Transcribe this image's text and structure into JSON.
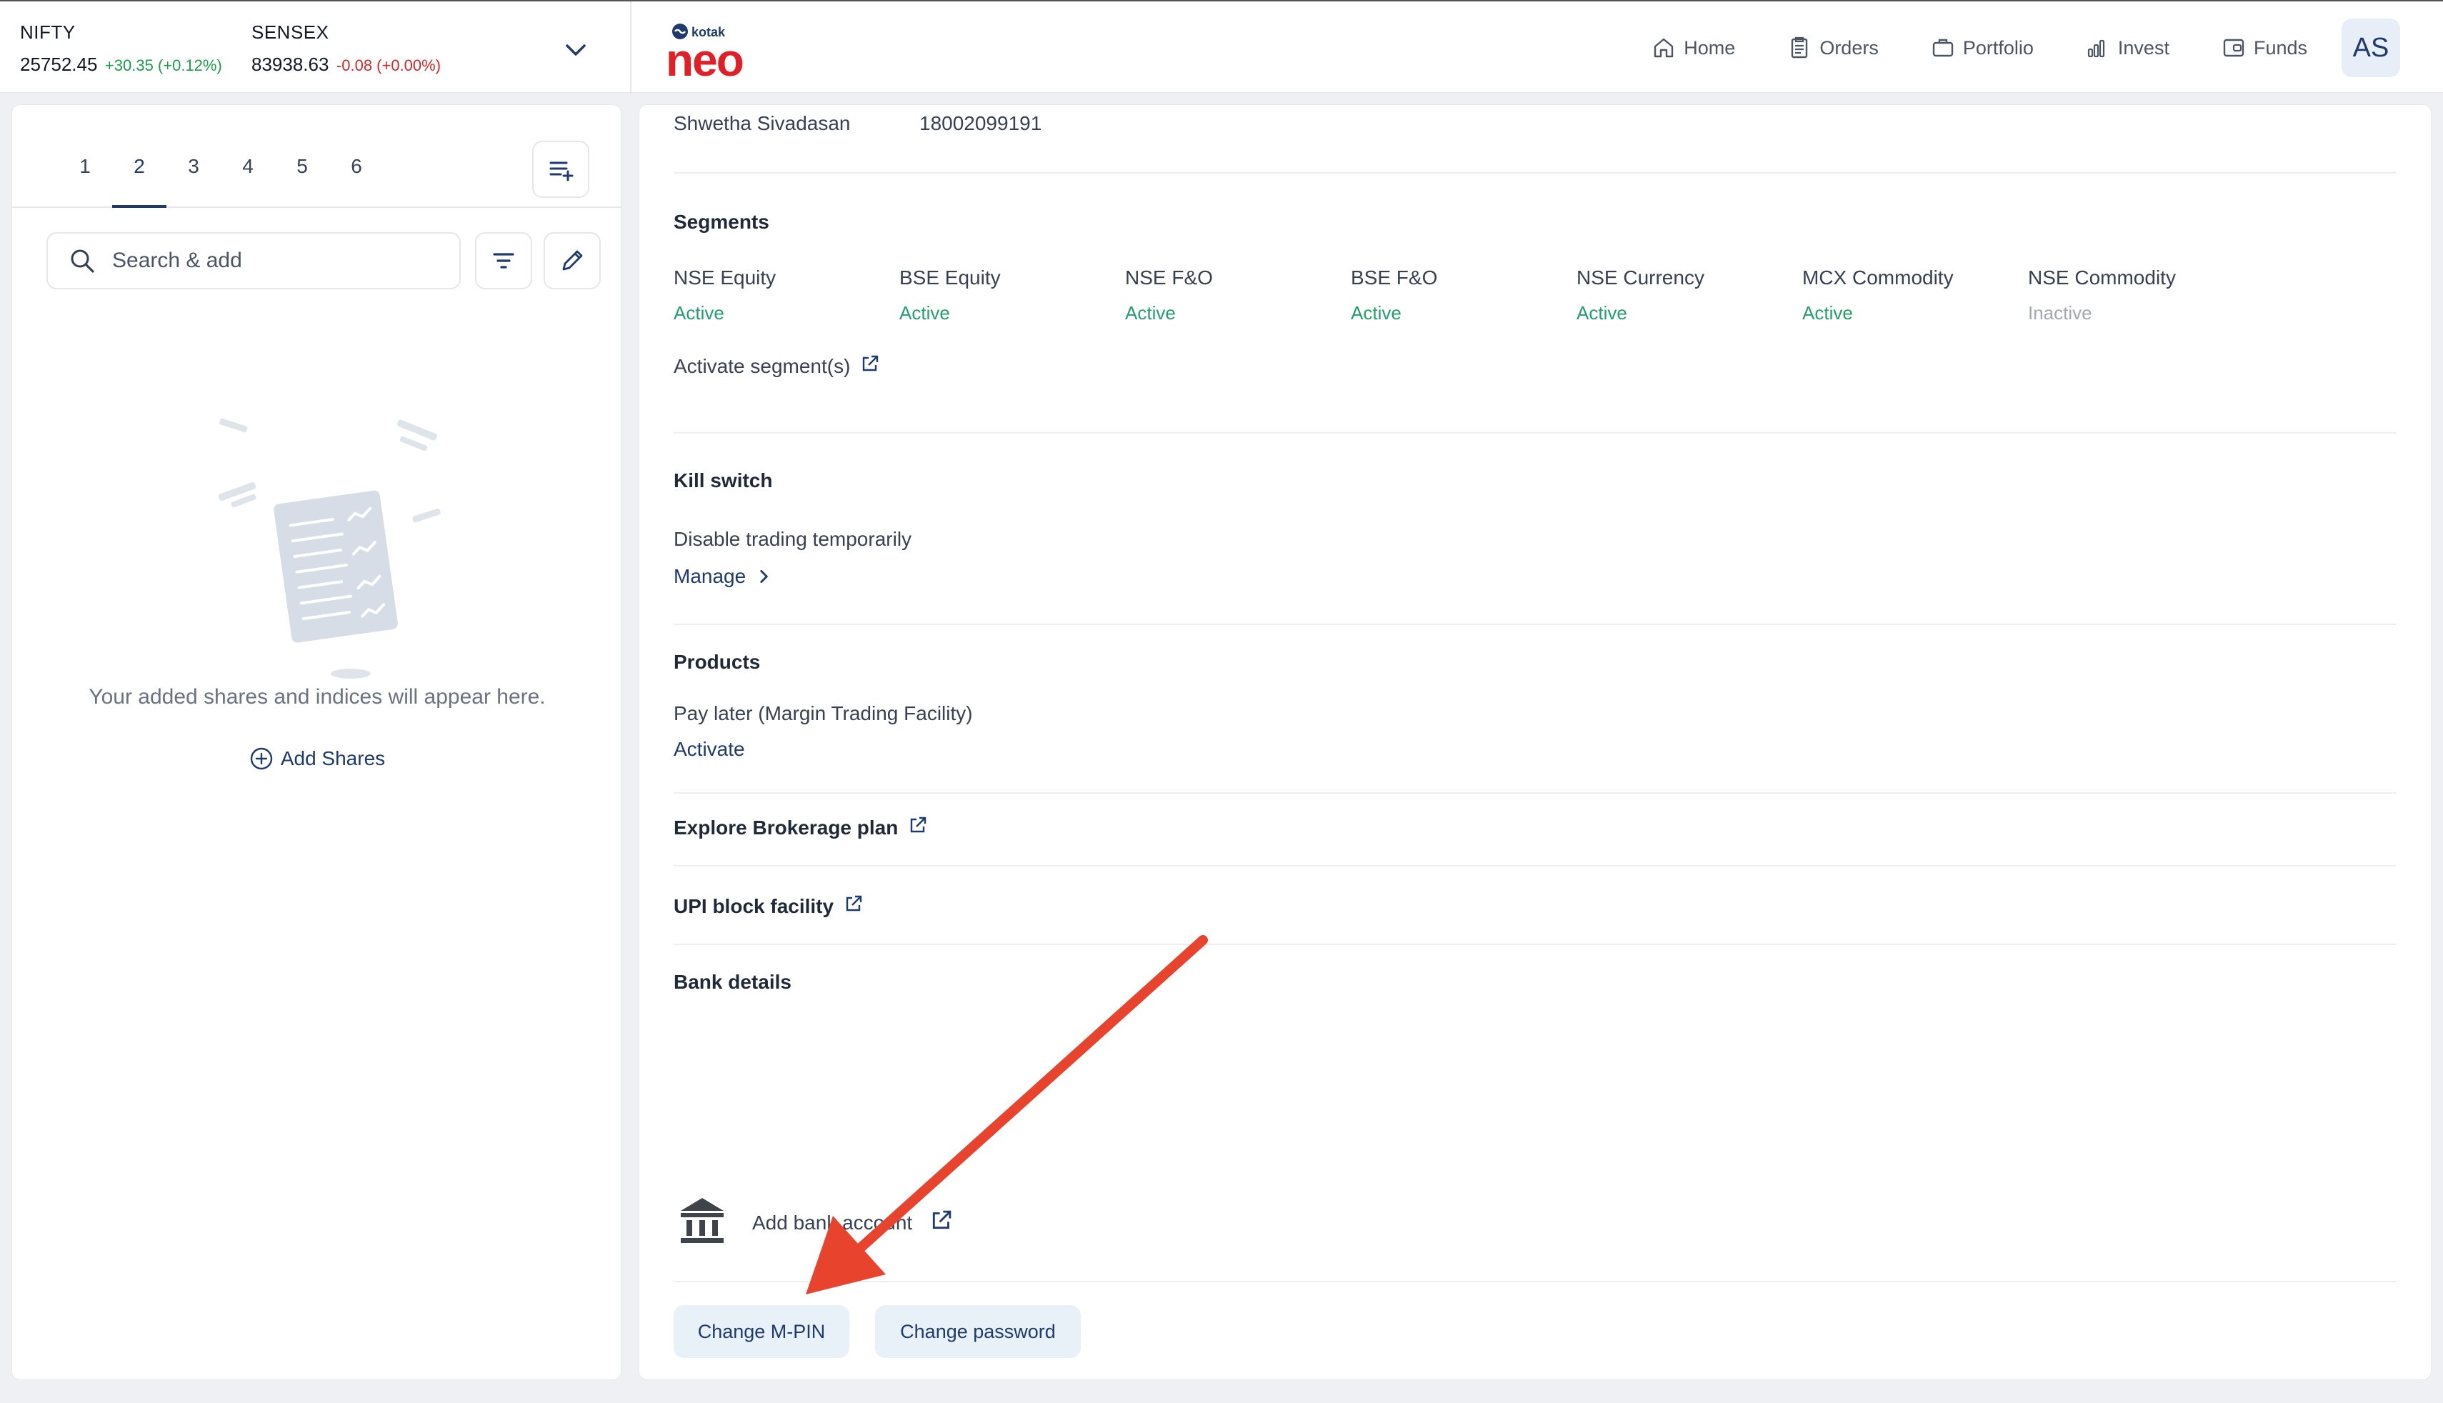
{
  "ticker": {
    "items": [
      {
        "name": "NIFTY",
        "price": "25752.45",
        "change": "+30.35 (+0.12%)"
      },
      {
        "name": "SENSEX",
        "price": "83938.63",
        "change": "-0.08 (+0.00%)"
      }
    ]
  },
  "logo": {
    "brand_small": "kotak",
    "brand_big": "neo"
  },
  "nav": {
    "home": "Home",
    "orders": "Orders",
    "portfolio": "Portfolio",
    "invest": "Invest",
    "funds": "Funds",
    "avatar": "AS"
  },
  "watchlist": {
    "tabs": [
      "1",
      "2",
      "3",
      "4",
      "5",
      "6"
    ],
    "active_tab": "2",
    "search_placeholder": "Search & add",
    "empty_text": "Your added shares and indices will appear here.",
    "add_shares": "Add Shares"
  },
  "profile": {
    "name": "Shwetha Sivadasan",
    "phone": "18002099191",
    "segments_heading": "Segments",
    "segments": [
      {
        "name": "NSE Equity",
        "status": "Active"
      },
      {
        "name": "BSE Equity",
        "status": "Active"
      },
      {
        "name": "NSE F&O",
        "status": "Active"
      },
      {
        "name": "BSE F&O",
        "status": "Active"
      },
      {
        "name": "NSE Currency",
        "status": "Active"
      },
      {
        "name": "MCX Commodity",
        "status": "Active"
      },
      {
        "name": "NSE Commodity",
        "status": "Inactive"
      }
    ],
    "activate_segments": "Activate segment(s)",
    "kill_switch_heading": "Kill switch",
    "kill_switch_desc": "Disable trading temporarily",
    "kill_switch_manage": "Manage",
    "products_heading": "Products",
    "products_desc": "Pay later (Margin Trading Facility)",
    "products_activate": "Activate",
    "brokerage_link": "Explore Brokerage plan",
    "upi_link": "UPI block facility",
    "bank_heading": "Bank details",
    "add_bank": "Add bank account",
    "change_mpin": "Change M-PIN",
    "change_password": "Change password"
  },
  "colors": {
    "brand_navy": "#1e3a6e",
    "brand_red": "#e21f26",
    "active_green": "#22a06b",
    "annotation_arrow": "#e8432d"
  }
}
